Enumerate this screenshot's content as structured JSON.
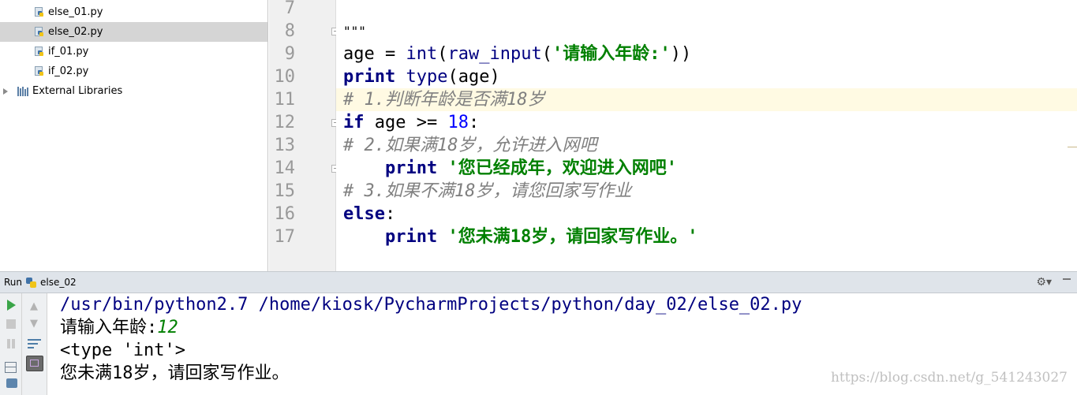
{
  "project_tree": {
    "files": [
      {
        "name": "else_01.py"
      },
      {
        "name": "else_02.py"
      },
      {
        "name": "if_01.py"
      },
      {
        "name": "if_02.py"
      }
    ],
    "external_libraries": "External Libraries"
  },
  "editor": {
    "line_numbers": [
      "7",
      "8",
      "9",
      "10",
      "11",
      "12",
      "13",
      "14",
      "15",
      "16",
      "17"
    ],
    "lines": {
      "l8": {
        "doc": "\"\"\""
      },
      "l9": {
        "var": "age",
        "eq": " = ",
        "fn1": "int",
        "p1": "(",
        "fn2": "raw_input",
        "p2": "(",
        "str": "'请输入年龄:'",
        "p3": "))"
      },
      "l10": {
        "kw": "print",
        "sp": " ",
        "fn": "type",
        "rest": "(age)"
      },
      "l11": {
        "comment": "# 1.判断年龄是否满18岁"
      },
      "l12": {
        "kw": "if",
        "mid": " age >= ",
        "num": "18",
        "end": ":"
      },
      "l13": {
        "comment": "# 2.如果满18岁，允许进入网吧"
      },
      "l14": {
        "indent": "    ",
        "kw": "print",
        "sp": " ",
        "str": "'您已经成年，欢迎进入网吧'"
      },
      "l15": {
        "comment": "# 3.如果不满18岁，请您回家写作业"
      },
      "l16": {
        "kw": "else",
        "end": ":"
      },
      "l17": {
        "indent": "    ",
        "kw": "print",
        "sp": " ",
        "str": "'您未满18岁，请回家写作业。'"
      }
    }
  },
  "run_panel": {
    "label": "Run",
    "config_name": "else_02",
    "icons": [
      "rerun-icon",
      "stop-icon",
      "pause-icon",
      "layout-icon",
      "print-icon",
      "up-arrow-icon",
      "down-arrow-icon",
      "soft-wrap-icon",
      "scroll-to-end-icon",
      "gear-icon",
      "minimize-icon"
    ]
  },
  "console": {
    "command": "/usr/bin/python2.7 /home/kiosk/PycharmProjects/python/day_02/else_02.py",
    "prompt": "请输入年龄:",
    "user_input": "12",
    "type_output": "<type 'int'>",
    "result": "您未满18岁，请回家写作业。"
  },
  "watermark": "https://blog.csdn.net/g_541243027"
}
